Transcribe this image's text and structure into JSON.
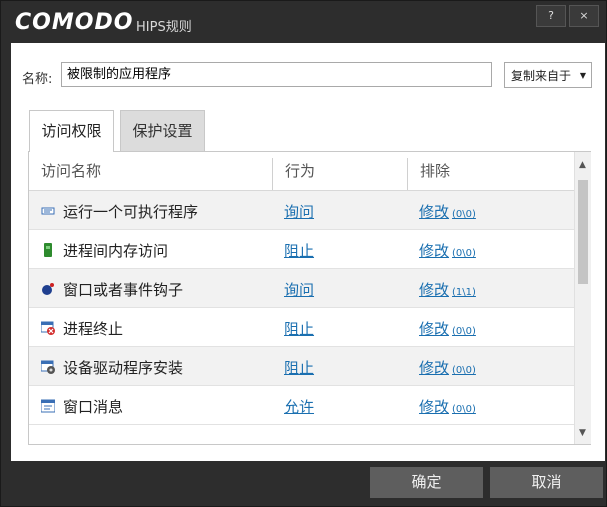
{
  "titlebar": {
    "brand": "COMODO",
    "subtitle": "HIPS规则",
    "help": "?",
    "close": "×"
  },
  "name_field": {
    "label": "名称:",
    "value": "被限制的应用程序"
  },
  "copy_button": {
    "label": "复制来自于",
    "caret": "▼"
  },
  "tabs": [
    {
      "label": "访问权限",
      "active": true
    },
    {
      "label": "保护设置",
      "active": false
    }
  ],
  "table": {
    "headers": {
      "name": "访问名称",
      "action": "行为",
      "exclude": "排除"
    },
    "rows": [
      {
        "icon": "executable-icon",
        "name": "运行一个可执行程序",
        "action": "询问",
        "modify": "修改",
        "count": "(0\\0)"
      },
      {
        "icon": "memory-icon",
        "name": "进程间内存访问",
        "action": "阻止",
        "modify": "修改",
        "count": "(0\\0)"
      },
      {
        "icon": "hook-icon",
        "name": "窗口或者事件钩子",
        "action": "询问",
        "modify": "修改",
        "count": "(1\\1)"
      },
      {
        "icon": "process-terminate-icon",
        "name": "进程终止",
        "action": "阻止",
        "modify": "修改",
        "count": "(0\\0)"
      },
      {
        "icon": "driver-install-icon",
        "name": "设备驱动程序安装",
        "action": "阻止",
        "modify": "修改",
        "count": "(0\\0)"
      },
      {
        "icon": "window-message-icon",
        "name": "窗口消息",
        "action": "允许",
        "modify": "修改",
        "count": "(0\\0)"
      }
    ]
  },
  "scrollbar": {
    "up": "▲",
    "down": "▼"
  },
  "footer": {
    "ok": "确定",
    "cancel": "取消"
  },
  "colors": {
    "chrome": "#2d2d2d",
    "link": "#1a6fb0",
    "footer_button": "#5e5e5e"
  }
}
